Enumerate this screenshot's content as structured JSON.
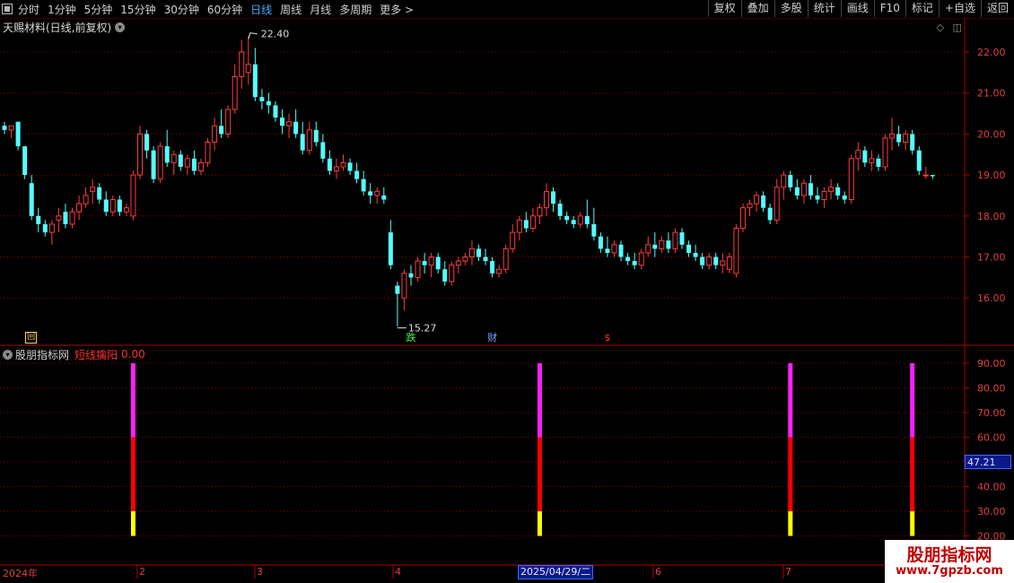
{
  "toolbar": {
    "periods": [
      "分时",
      "1分钟",
      "5分钟",
      "15分钟",
      "30分钟",
      "60分钟",
      "日线",
      "周线",
      "月线",
      "多周期",
      "更多 >"
    ],
    "active_period": "日线",
    "right_buttons": [
      "复权",
      "叠加",
      "多股",
      "统计",
      "画线",
      "F10",
      "标记",
      "+自选",
      "返回"
    ]
  },
  "stock": {
    "title": "天赐材料(日线,前复权)"
  },
  "price_axis": {
    "labels": [
      "22.00",
      "21.00",
      "20.00",
      "19.00",
      "18.00",
      "17.00",
      "16.00"
    ]
  },
  "annotations": {
    "high": "22.40",
    "low": "15.27"
  },
  "markers": [
    {
      "label": "回",
      "color": "#ffd060"
    },
    {
      "label": "跌",
      "color": "#40ff40"
    },
    {
      "label": "财",
      "color": "#6fa8ff"
    },
    {
      "label": "$",
      "color": "#ff3030"
    }
  ],
  "indicator": {
    "name": "股朋指标网",
    "line_name": "短线擒阳",
    "line_value": "0.00",
    "current": "47.21",
    "axis": [
      "90.00",
      "80.00",
      "70.00",
      "60.00",
      "50.00",
      "40.00",
      "30.00",
      "20.00"
    ]
  },
  "time_axis": {
    "labels": [
      "2024年",
      "2",
      "3",
      "4",
      "6",
      "7"
    ],
    "highlight": "2025/04/29/二"
  },
  "watermark": {
    "title": "股朋指标网",
    "url": "www.7gpzb.com"
  },
  "colors": {
    "up": "#ff3c3c",
    "down": "#54ffff",
    "grid": "#8a0000",
    "magenta": "#ff20ff",
    "red": "#ff0000",
    "yellow": "#ffff00"
  },
  "chart_data": [
    {
      "type": "candlestick",
      "title": "天赐材料(日线,前复权)",
      "ylim": [
        15.0,
        22.6
      ],
      "series": [
        {
          "name": "price",
          "high_label": 22.4,
          "low_label": 15.27,
          "ohlc": [
            [
              20.2,
              20.3,
              20.0,
              20.1
            ],
            [
              20.1,
              20.2,
              19.9,
              20.2
            ],
            [
              20.3,
              20.3,
              19.6,
              19.7
            ],
            [
              19.7,
              19.7,
              18.9,
              19.0
            ],
            [
              18.8,
              19.0,
              17.9,
              18.0
            ],
            [
              18.0,
              18.2,
              17.6,
              17.8
            ],
            [
              17.8,
              17.9,
              17.5,
              17.6
            ],
            [
              17.6,
              17.9,
              17.3,
              17.8
            ],
            [
              17.9,
              18.2,
              17.6,
              18.0
            ],
            [
              18.1,
              18.3,
              17.7,
              17.8
            ],
            [
              17.8,
              18.2,
              17.7,
              18.1
            ],
            [
              18.1,
              18.5,
              17.9,
              18.3
            ],
            [
              18.3,
              18.7,
              18.2,
              18.5
            ],
            [
              18.6,
              18.9,
              18.3,
              18.7
            ],
            [
              18.7,
              18.8,
              18.3,
              18.4
            ],
            [
              18.4,
              18.6,
              18.0,
              18.1
            ],
            [
              18.1,
              18.5,
              18.0,
              18.4
            ],
            [
              18.4,
              18.5,
              18.0,
              18.1
            ],
            [
              18.1,
              18.3,
              18.0,
              18.2
            ],
            [
              18.0,
              19.1,
              17.9,
              19.0
            ],
            [
              19.0,
              20.2,
              18.9,
              20.0
            ],
            [
              20.0,
              20.1,
              19.4,
              19.6
            ],
            [
              19.6,
              19.7,
              18.8,
              18.9
            ],
            [
              18.9,
              19.8,
              18.8,
              19.7
            ],
            [
              19.7,
              20.1,
              19.2,
              19.3
            ],
            [
              19.3,
              19.6,
              19.0,
              19.5
            ],
            [
              19.5,
              19.6,
              19.1,
              19.2
            ],
            [
              19.2,
              19.5,
              19.0,
              19.4
            ],
            [
              19.4,
              19.6,
              19.0,
              19.1
            ],
            [
              19.1,
              19.4,
              19.0,
              19.3
            ],
            [
              19.3,
              19.9,
              19.2,
              19.8
            ],
            [
              19.8,
              20.4,
              19.6,
              20.2
            ],
            [
              20.2,
              20.6,
              19.9,
              20.0
            ],
            [
              20.0,
              20.7,
              19.9,
              20.6
            ],
            [
              20.6,
              21.7,
              20.5,
              21.4
            ],
            [
              21.4,
              22.3,
              21.1,
              22.0
            ],
            [
              21.5,
              22.4,
              21.2,
              21.7
            ],
            [
              21.7,
              22.1,
              20.8,
              20.9
            ],
            [
              20.9,
              21.1,
              20.6,
              20.8
            ],
            [
              20.8,
              21.0,
              20.5,
              20.7
            ],
            [
              20.7,
              20.8,
              20.3,
              20.4
            ],
            [
              20.4,
              20.6,
              20.0,
              20.2
            ],
            [
              20.2,
              20.5,
              19.9,
              20.3
            ],
            [
              20.3,
              20.6,
              19.9,
              20.0
            ],
            [
              20.0,
              20.3,
              19.5,
              19.6
            ],
            [
              19.6,
              20.3,
              19.5,
              20.1
            ],
            [
              20.1,
              20.3,
              19.7,
              19.8
            ],
            [
              19.8,
              20.0,
              19.3,
              19.4
            ],
            [
              19.4,
              19.6,
              19.0,
              19.1
            ],
            [
              19.1,
              19.4,
              18.9,
              19.2
            ],
            [
              19.2,
              19.5,
              19.1,
              19.3
            ],
            [
              19.3,
              19.4,
              19.0,
              19.1
            ],
            [
              19.1,
              19.3,
              18.8,
              18.9
            ],
            [
              18.9,
              19.1,
              18.5,
              18.6
            ],
            [
              18.6,
              18.8,
              18.3,
              18.5
            ],
            [
              18.5,
              18.7,
              18.3,
              18.6
            ],
            [
              18.5,
              18.7,
              18.3,
              18.4
            ],
            [
              17.6,
              17.9,
              16.7,
              16.8
            ],
            [
              16.3,
              16.4,
              15.3,
              16.1
            ],
            [
              16.0,
              16.7,
              15.7,
              16.6
            ],
            [
              16.6,
              16.8,
              16.3,
              16.5
            ],
            [
              16.5,
              17.0,
              16.4,
              16.9
            ],
            [
              16.9,
              17.1,
              16.6,
              16.8
            ],
            [
              16.8,
              17.1,
              16.5,
              17.0
            ],
            [
              17.0,
              17.1,
              16.6,
              16.7
            ],
            [
              16.7,
              16.9,
              16.3,
              16.4
            ],
            [
              16.4,
              16.9,
              16.3,
              16.8
            ],
            [
              16.8,
              17.0,
              16.6,
              16.9
            ],
            [
              16.9,
              17.1,
              16.8,
              17.0
            ],
            [
              17.0,
              17.4,
              16.8,
              17.2
            ],
            [
              17.2,
              17.3,
              16.9,
              17.0
            ],
            [
              17.0,
              17.2,
              16.8,
              16.9
            ],
            [
              16.9,
              17.0,
              16.5,
              16.6
            ],
            [
              16.6,
              16.8,
              16.5,
              16.7
            ],
            [
              16.7,
              17.3,
              16.6,
              17.2
            ],
            [
              17.2,
              17.8,
              17.1,
              17.6
            ],
            [
              17.6,
              18.0,
              17.4,
              17.9
            ],
            [
              17.9,
              18.1,
              17.6,
              17.7
            ],
            [
              17.7,
              18.2,
              17.6,
              18.0
            ],
            [
              18.0,
              18.3,
              17.8,
              18.2
            ],
            [
              18.2,
              18.8,
              18.0,
              18.6
            ],
            [
              18.6,
              18.7,
              18.1,
              18.3
            ],
            [
              18.3,
              18.4,
              17.9,
              18.0
            ],
            [
              18.0,
              18.1,
              17.8,
              17.9
            ],
            [
              17.9,
              18.0,
              17.7,
              17.8
            ],
            [
              17.8,
              18.1,
              17.7,
              18.0
            ],
            [
              18.0,
              18.4,
              17.7,
              17.8
            ],
            [
              17.8,
              18.2,
              17.4,
              17.5
            ],
            [
              17.5,
              17.6,
              17.1,
              17.2
            ],
            [
              17.2,
              17.5,
              17.0,
              17.1
            ],
            [
              17.1,
              17.4,
              17.0,
              17.3
            ],
            [
              17.3,
              17.4,
              16.9,
              17.0
            ],
            [
              17.0,
              17.1,
              16.8,
              16.9
            ],
            [
              16.9,
              17.1,
              16.7,
              16.8
            ],
            [
              16.8,
              17.2,
              16.7,
              17.1
            ],
            [
              17.1,
              17.5,
              17.0,
              17.3
            ],
            [
              17.3,
              17.6,
              17.0,
              17.2
            ],
            [
              17.2,
              17.5,
              17.1,
              17.4
            ],
            [
              17.4,
              17.6,
              17.1,
              17.2
            ],
            [
              17.2,
              17.7,
              17.1,
              17.6
            ],
            [
              17.6,
              17.7,
              17.2,
              17.3
            ],
            [
              17.3,
              17.4,
              17.0,
              17.1
            ],
            [
              17.1,
              17.3,
              16.9,
              17.0
            ],
            [
              17.0,
              17.1,
              16.7,
              16.8
            ],
            [
              16.8,
              17.1,
              16.7,
              17.0
            ],
            [
              17.0,
              17.1,
              16.7,
              16.8
            ],
            [
              16.8,
              17.1,
              16.6,
              16.9
            ],
            [
              16.7,
              17.1,
              16.6,
              17.0
            ],
            [
              16.6,
              17.8,
              16.5,
              17.7
            ],
            [
              17.7,
              18.3,
              17.6,
              18.2
            ],
            [
              18.2,
              18.4,
              18.0,
              18.3
            ],
            [
              18.3,
              18.6,
              18.1,
              18.5
            ],
            [
              18.5,
              18.6,
              18.1,
              18.2
            ],
            [
              18.2,
              18.3,
              17.8,
              17.9
            ],
            [
              17.9,
              18.9,
              17.8,
              18.7
            ],
            [
              18.7,
              19.1,
              18.4,
              19.0
            ],
            [
              19.0,
              19.1,
              18.6,
              18.7
            ],
            [
              18.7,
              18.9,
              18.4,
              18.5
            ],
            [
              18.5,
              18.9,
              18.3,
              18.8
            ],
            [
              18.8,
              19.0,
              18.4,
              18.5
            ],
            [
              18.5,
              18.7,
              18.3,
              18.4
            ],
            [
              18.4,
              18.7,
              18.2,
              18.6
            ],
            [
              18.6,
              18.9,
              18.4,
              18.7
            ],
            [
              18.7,
              18.8,
              18.4,
              18.5
            ],
            [
              18.5,
              18.6,
              18.3,
              18.4
            ],
            [
              18.4,
              19.5,
              18.3,
              19.4
            ],
            [
              19.4,
              19.8,
              19.1,
              19.6
            ],
            [
              19.6,
              19.7,
              19.2,
              19.3
            ],
            [
              19.3,
              19.6,
              19.1,
              19.4
            ],
            [
              19.4,
              19.5,
              19.1,
              19.2
            ],
            [
              19.2,
              20.0,
              19.1,
              19.9
            ],
            [
              19.9,
              20.4,
              19.6,
              20.0
            ],
            [
              20.0,
              20.2,
              19.7,
              19.8
            ],
            [
              19.8,
              20.1,
              19.6,
              20.0
            ],
            [
              20.0,
              20.1,
              19.5,
              19.6
            ],
            [
              19.6,
              19.7,
              19.0,
              19.1
            ],
            [
              19.0,
              19.2,
              18.9,
              19.0
            ],
            [
              19.0,
              19.0,
              18.9,
              18.97
            ]
          ]
        }
      ]
    },
    {
      "type": "bar",
      "title": "股朋指标网",
      "series": [
        {
          "name": "短线擒阳",
          "signals": [
            {
              "bar_index": 19,
              "segments": [
                [
                  20,
                  30,
                  "yellow"
                ],
                [
                  30,
                  60,
                  "red"
                ],
                [
                  60,
                  90,
                  "magenta"
                ]
              ]
            },
            {
              "bar_index": 79,
              "segments": [
                [
                  20,
                  30,
                  "yellow"
                ],
                [
                  30,
                  60,
                  "red"
                ],
                [
                  60,
                  90,
                  "magenta"
                ]
              ]
            },
            {
              "bar_index": 116,
              "segments": [
                [
                  20,
                  30,
                  "yellow"
                ],
                [
                  30,
                  60,
                  "red"
                ],
                [
                  60,
                  90,
                  "magenta"
                ]
              ]
            },
            {
              "bar_index": 134,
              "segments": [
                [
                  20,
                  30,
                  "yellow"
                ],
                [
                  30,
                  60,
                  "red"
                ],
                [
                  60,
                  90,
                  "magenta"
                ]
              ]
            }
          ]
        }
      ],
      "ylim": [
        18,
        92
      ]
    }
  ]
}
